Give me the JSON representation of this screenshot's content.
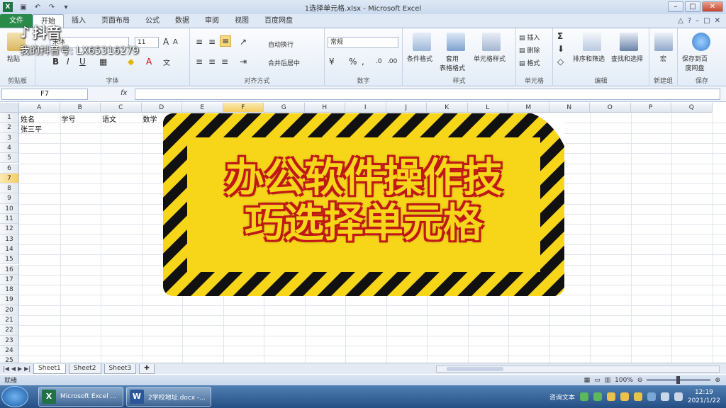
{
  "window": {
    "title": "1选择单元格.xlsx - Microsoft Excel",
    "app_icon": "X"
  },
  "qat": {
    "save": "save-icon",
    "undo": "undo-icon",
    "redo": "redo-icon"
  },
  "tabs": [
    {
      "label": "文件",
      "active": false
    },
    {
      "label": "开始",
      "active": true
    },
    {
      "label": "插入",
      "active": false
    },
    {
      "label": "页面布局",
      "active": false
    },
    {
      "label": "公式",
      "active": false
    },
    {
      "label": "数据",
      "active": false
    },
    {
      "label": "审阅",
      "active": false
    },
    {
      "label": "视图",
      "active": false
    },
    {
      "label": "百度网盘",
      "active": false
    }
  ],
  "ribbon": {
    "clipboard": {
      "paste": "粘贴",
      "label": "剪贴板"
    },
    "font": {
      "name": "宋体",
      "size": "11",
      "label": "字体",
      "bold": "B",
      "italic": "I",
      "underline": "U"
    },
    "align": {
      "wrap": "自动换行",
      "merge": "合并后居中",
      "label": "对齐方式"
    },
    "number": {
      "format": "常规",
      "percent": "%",
      "label": "数字"
    },
    "styles": {
      "cond": "条件格式",
      "table": "套用\n表格格式",
      "cell_style": "单元格样式",
      "label": "样式"
    },
    "cells": {
      "insert": "插入",
      "delete": "删除",
      "format": "格式",
      "label": "单元格"
    },
    "editing": {
      "sum": "Σ",
      "sort": "排序和筛选",
      "find": "查找和选择",
      "label": "编辑"
    },
    "newgroup": {
      "macro": "宏",
      "label": "新建组"
    },
    "save": {
      "baidu": "保存到百\n度网盘",
      "label": "保存"
    }
  },
  "formula": {
    "namebox": "F7",
    "fx": "fx",
    "value": ""
  },
  "columns": [
    "A",
    "B",
    "C",
    "D",
    "E",
    "F",
    "G",
    "H",
    "I",
    "J",
    "K",
    "L",
    "M",
    "N",
    "O",
    "P",
    "Q"
  ],
  "selected_column": "F",
  "rows": [
    "1",
    "2",
    "3",
    "4",
    "5",
    "6",
    "7",
    "8",
    "9",
    "10",
    "11",
    "12",
    "13",
    "14",
    "15",
    "16",
    "17",
    "18",
    "19",
    "20",
    "21",
    "22",
    "23",
    "24",
    "25"
  ],
  "selected_row": "7",
  "cells": {
    "a1": "姓名",
    "b1": "学号",
    "c1": "语文",
    "d1": "数学",
    "a2": "张三平"
  },
  "sheets": [
    {
      "label": "Sheet1",
      "active": true
    },
    {
      "label": "Sheet2",
      "active": false
    },
    {
      "label": "Sheet3",
      "active": false
    }
  ],
  "status": {
    "ready": "就绪",
    "zoom": "100%"
  },
  "taskbar": {
    "items": [
      {
        "label": "Microsoft Excel ...",
        "icon": "X",
        "color": "#1f7244"
      },
      {
        "label": "2学校地址.docx -...",
        "icon": "W",
        "color": "#2b579a"
      }
    ],
    "tray_text": "咨询文本",
    "time": "12:19",
    "date": "2021/1/22"
  },
  "overlay": {
    "watermark_name": "抖音",
    "watermark_id": "我的抖音号: LX65316279",
    "banner_line1": "办公软件操作技",
    "banner_line2": "巧选择单元格"
  },
  "colors": {
    "file_tab": "#2a8a4a",
    "banner_yellow": "#f7d61a",
    "banner_outline": "#c01717",
    "selection_highlight": "#f5cd62"
  }
}
